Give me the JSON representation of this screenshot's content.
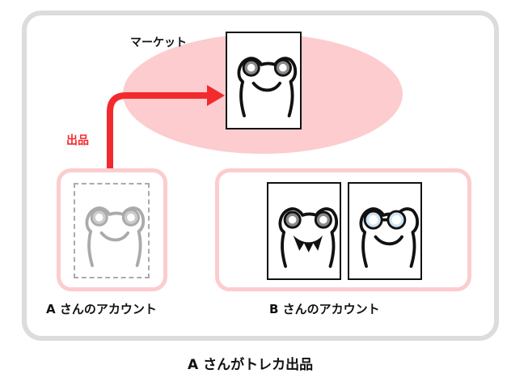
{
  "market": {
    "label": "マーケット"
  },
  "sell": {
    "label": "出品"
  },
  "account_a": {
    "label": "A さんのアカウント"
  },
  "account_b": {
    "label": "B さんのアカウント"
  },
  "caption": "A さんがトレカ出品",
  "colors": {
    "pink_fill": "#fccccf",
    "arrow_red": "#f22a2e",
    "frame_gray": "#dcdcdc",
    "ghost_gray": "#aaaaaa"
  },
  "icons": [
    "frog-card-icon",
    "frog-card-fanged-icon",
    "frog-card-glasses-icon",
    "arrow-right-icon"
  ]
}
